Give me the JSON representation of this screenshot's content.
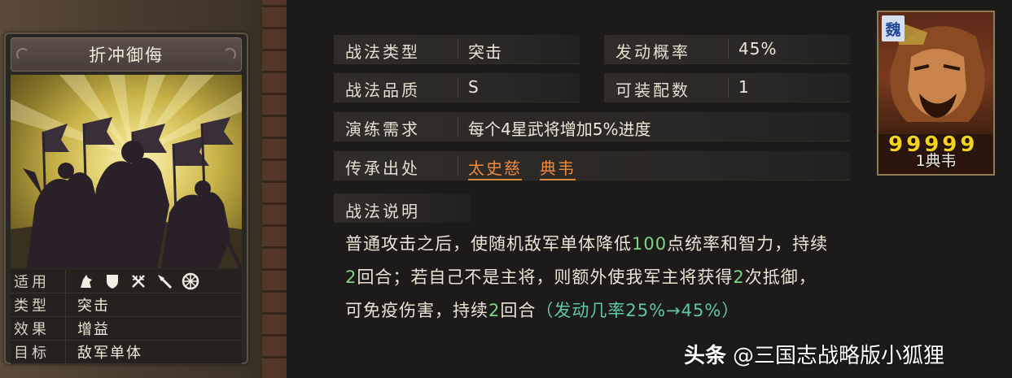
{
  "card": {
    "title": "折冲御侮",
    "attributes": [
      {
        "key": "适用",
        "value": ""
      },
      {
        "key": "类型",
        "value": "突击"
      },
      {
        "key": "效果",
        "value": "增益"
      },
      {
        "key": "目标",
        "value": "敌军单体"
      }
    ],
    "troop_icons": [
      "cavalry-icon",
      "shield-icon",
      "crossed-bows-icon",
      "spear-icon",
      "siege-wheel-icon"
    ]
  },
  "info": {
    "type_label": "战法类型",
    "type_value": "突击",
    "rate_label": "发动概率",
    "rate_value": "45%",
    "quality_label": "战法品质",
    "quality_value": "S",
    "equip_label": "可装配数",
    "equip_value": "1",
    "train_label": "演练需求",
    "train_value": "每个4星武将增加5%进度",
    "source_label": "传承出处",
    "sources": [
      "太史慈",
      "典韦"
    ]
  },
  "description": {
    "heading": "战法说明",
    "p1": "普通攻击之后，使随机敌军单体降低",
    "n1": "100",
    "p2": "点统率和智力，持续",
    "n2": "2",
    "p3": "回合；若自己不是主将，则额外使我军主将获得",
    "n3": "2",
    "p4": "次抵御，",
    "p5": "可免疫伤害，持续",
    "n4": "2",
    "p6": "回合",
    "rate_note": "（发动几率25%→45%）"
  },
  "portrait": {
    "faction": "魏",
    "stars": "99999",
    "name": "1典韦"
  },
  "watermark": {
    "brand": "头条",
    "account": "@三国志战略版小狐狸"
  },
  "colors": {
    "link": "#f08a3a",
    "number": "#7fd486",
    "rate_note": "#5ec7a8",
    "star": "#f4d21e"
  }
}
